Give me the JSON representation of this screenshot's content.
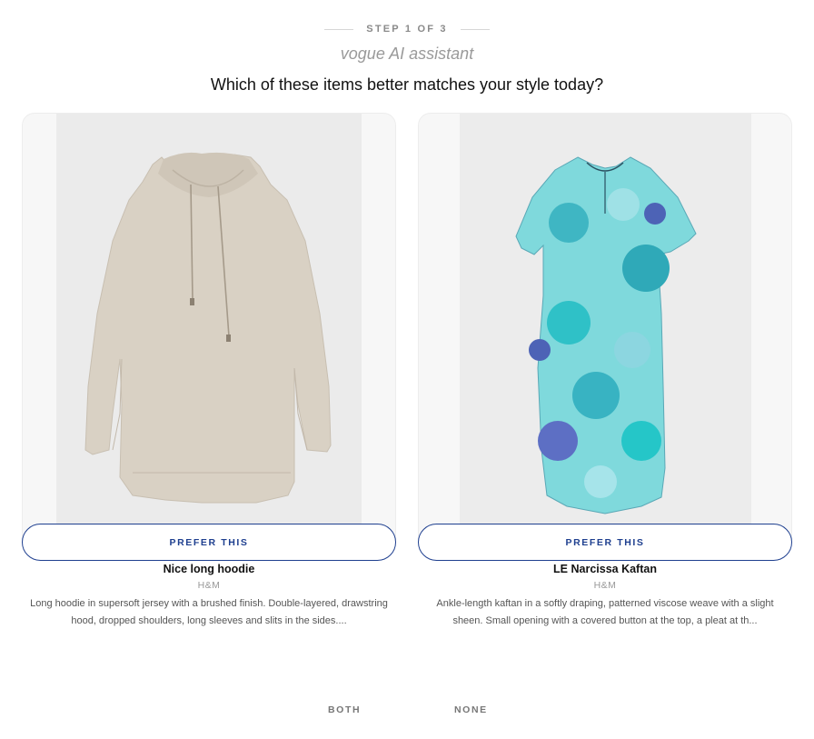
{
  "header": {
    "step": "STEP 1 OF 3",
    "assistant": "vogue AI assistant",
    "question": "Which of these items better matches your style today?"
  },
  "items": [
    {
      "name": "Nice long hoodie",
      "brand": "H&M",
      "description": "Long hoodie in supersoft jersey with a brushed finish. Double-layered, drawstring hood, dropped shoulders, long sleeves and slits in the sides....",
      "button": "PREFER THIS",
      "image": "beige-hoodie-photo"
    },
    {
      "name": "LE Narcissa Kaftan",
      "brand": "H&M",
      "description": "Ankle-length kaftan in a softly draping, patterned viscose weave with a slight sheen. Small opening with a covered button at the top, a pleat at th...",
      "button": "PREFER THIS",
      "image": "floral-kaftan-photo"
    }
  ],
  "footer": {
    "both": "BOTH",
    "none": "NONE"
  },
  "colors": {
    "accent": "#1e3f8f",
    "hoodie": "#d8d0c4",
    "kaftan": "#4fd0d6"
  }
}
